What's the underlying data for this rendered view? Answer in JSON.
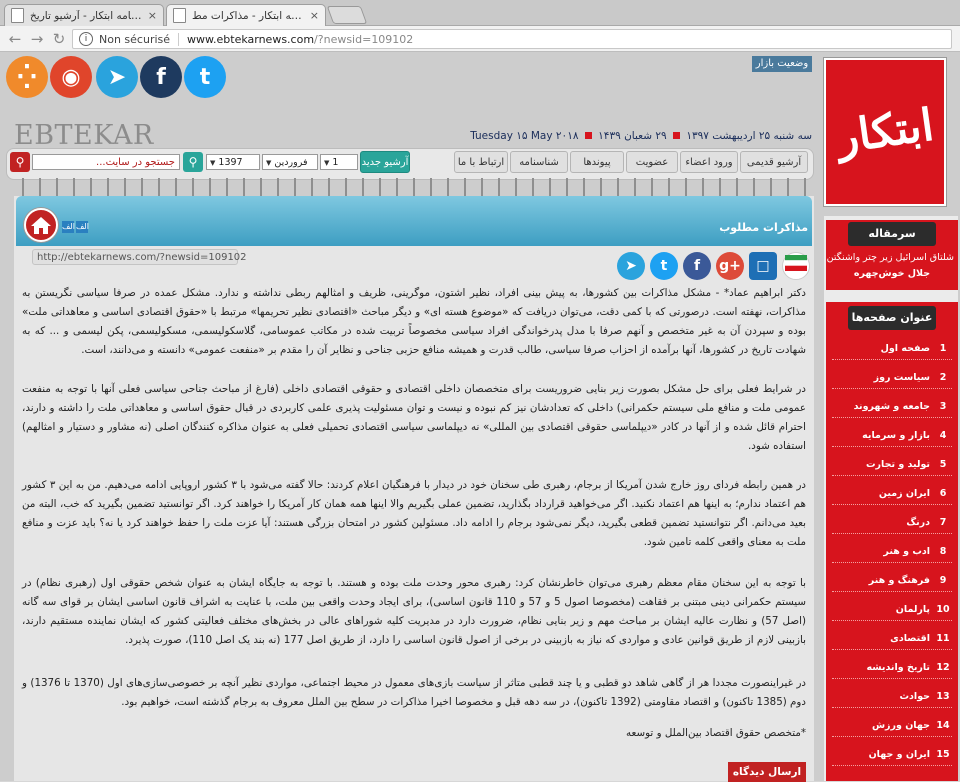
{
  "browser": {
    "tabs": [
      {
        "title": "روزنامه ابتکار - آرشیو تاریخ",
        "close": "×"
      },
      {
        "title": "روزنامه ابتکار - مذاکرات مط",
        "close": "×"
      }
    ],
    "security_label": "Non sécurisé",
    "url_host": "www.ebtekarnews.com",
    "url_path": "/?newsid=109102"
  },
  "header": {
    "logo_text": "ابتکار",
    "brand": "EBTEKAR NEWSPAPER",
    "market_status": "وضعیت بازار",
    "date_persian": "سه شنبه ۲۵ اردیبهشت ۱۳۹۷",
    "date_hijri": "۲۹ شعبان ۱۴۳۹",
    "date_gregorian": "Tuesday ۱۵ May ۲۰۱۸"
  },
  "social_icons": [
    "twitter-icon",
    "facebook-icon",
    "telegram-icon",
    "instagram-icon",
    "rss-icon"
  ],
  "toolbar": {
    "menu": [
      "آرشیو قدیمی",
      "ورود اعضاء",
      "عضویت",
      "پیوندها",
      "شناسنامه",
      "ارتباط با ما"
    ],
    "archive_new": "آرشیو جدید",
    "day_value": "1",
    "month_value": "فروردین",
    "year_value": "1397",
    "search_placeholder": "جستجو در سایت..."
  },
  "article": {
    "title": "مذاکرات مطلوب",
    "font_large": "الف",
    "font_small": "الف",
    "short_url": "http://ebtekarnews.com/?newsid=109102",
    "paragraphs": [
      "دکتر ابراهیم عماد* - مشکل مذاکرات بین کشورها، به پیش بینی افراد، نظیر اشتون، موگرینی، ظریف و امثالهم ربطی نداشته و ندارد. مشکل عمده در صرفا سیاسی نگریستن به مذاکرات، نهفته است. درصورتی که با کمی دقت، می‌توان دریافت که «موضوع هسته ای» و دیگر مباحث «اقتصادی نظیر تحریمها» مرتبط با «حقوق اقتصادی اساسی و معاهداتی ملت» بوده و سپردن آن به غیر متخصص و آنهم صرفا با مدل پدرخواندگی افراد سیاسی مخصوصاً تربیت شده در مکاتب عموسامی، گلاسکولیسمی، مسکولیسمی، پکن لیسمی و ... که به شهادت تاریخ در کشورها، آنها برآمده از احزاب صرفا سیاسی، طالب قدرت و همیشه منافع حزبی جناحی و نظایر آن را مقدم بر «منفعت عمومی» دانسته و می‌دانند، است.",
      "در شرایط فعلی برای حل مشکل بصورت زیر بنایی ضروریست برای متخصصان داخلی اقتصادی و حقوقی اقتصادی داخلی (فارغ از مباحث جناحی سیاسی فعلی آنها با توجه به منفعت عمومی ملت و منافع ملی سیستم حکمرانی) داخلی که تعدادشان نیز کم نبوده و نیست و توان مسئولیت پذیری علمی کاربردی در قبال حقوق اساسی و معاهداتی ملت را داشته و دارند، احترام قائل شده و از آنها در کادر «دیپلماسی حقوقی اقتصادی بین المللی» نه دیپلماسی سیاسی اقتصادی تحمیلی فعلی به عنوان مذاکره کنندگان اصلی (نه مشاور و دستیار و امثالهم) استفاده شود.",
      "در همین رابطه فردای روز خارج شدن آمریکا از برجام، رهبری طی سخنان خود در دیدار با فرهنگیان اعلام کردند: حالا گفته می‌شود با ۳ کشور اروپایی ادامه می‌دهیم. من به این ۳ کشور هم اعتماد ندارم؛ به اینها هم اعتماد نکنید. اگر می‌خواهید قرارداد بگذارید، تضمین عملی بگیریم والا اینها همه همان کار آمریکا را خواهند کرد. اگر توانستید تضمین بگیرید که خب، البته من بعید می‌دانم. اگر نتوانستید تضمین قطعی بگیرید، دیگر نمی‌شود برجام را ادامه داد. مسئولین کشور در امتحان بزرگی هستند: آیا عزت ملت را حفظ خواهند کرد یا نه؟ باید عزت و منافع ملت به معنای واقعی کلمه تامین شود.",
      "با توجه به این سخنان مقام معظم رهبری می‌توان خاطرنشان کرد: رهبری محور وحدت ملت بوده و هستند. با توجه به جایگاه ایشان به عنوان شخص حقوقی اول (رهبری نظام) در سیستم حکمرانی دینی مبتنی بر فقاهت (مخصوصا اصول 5 و 57 و 110 قانون اساسی)، برای ایجاد وحدت واقعی بین ملت، با عنایت به اشراف قانون اساسی ایشان بر قوای سه گانه (اصل 57) و نظارت عالیه ایشان بر مباحث مهم و زیر بنایی نظام، ضرورت دارد در مدیریت کلیه شوراهای عالی در بخش‌های مختلف فعالیتی کشور که ایشان نماینده مستقیم دارند، بازبینی لازم از طریق قوانین عادی و مواردی که نیاز به بازبینی در برخی از اصول قانون اساسی را دارد، از طریق اصل 177 (نه بند یک اصل 110)، صورت پذیرد.",
      "در غیراینصورت مجددا هر از گاهی شاهد دو قطبی و یا چند قطبی متاثر از سیاست بازی‌های معمول در محیط اجتماعی، مواردی نظیر آنچه بر خصوصی‌سازی‌های اول (1370 تا 1376) و دوم (1385 تاکنون) و اقتصاد مقاومتی (1392 تاکنون)، در سه دهه قبل و مخصوصا اخیرا مذاکرات در سطح بین الملل معروف به برجام گذشته است، خواهیم بود.",
      "*متخصص حقوق اقتصاد بین‌الملل و توسعه"
    ],
    "send_comment": "ارسال دیدگاه"
  },
  "sidebar": {
    "editorial_title": "سرمقاله",
    "editorial_line1": "شلتاق اسرائیل زیر چتر واشنگتن",
    "editorial_author": "جلال خوش‌چهره",
    "pages_title": "عنوان صفحه‌ها",
    "pages": [
      {
        "num": "1",
        "name": "صفحه اول"
      },
      {
        "num": "2",
        "name": "سیاست روز"
      },
      {
        "num": "3",
        "name": "جامعه و شهروند"
      },
      {
        "num": "4",
        "name": "بازار و سرمایه"
      },
      {
        "num": "5",
        "name": "تولید و تجارت"
      },
      {
        "num": "6",
        "name": "ایران زمین"
      },
      {
        "num": "7",
        "name": "درنگ"
      },
      {
        "num": "8",
        "name": "ادب و هنر"
      },
      {
        "num": "9",
        "name": "فرهنگ و هنر"
      },
      {
        "num": "10",
        "name": "پارلمان"
      },
      {
        "num": "11",
        "name": "اقتصادی"
      },
      {
        "num": "12",
        "name": "تاریخ واندیشه"
      },
      {
        "num": "13",
        "name": "حوادث"
      },
      {
        "num": "14",
        "name": "جهان ورزش"
      },
      {
        "num": "15",
        "name": "ایران و جهان"
      }
    ]
  },
  "colors": {
    "brand_red": "#d7141d",
    "title_blue": "#3d9ec2",
    "archive_green": "#2aa59a"
  }
}
